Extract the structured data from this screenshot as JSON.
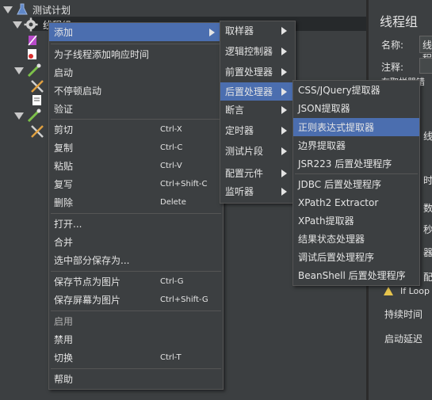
{
  "tree": {
    "root_label": "测试计划",
    "selected_label": "线程组",
    "colors": {
      "selection": "#26292b",
      "menu_highlight": "#4b6eaf"
    }
  },
  "right_panel": {
    "title": "线程组",
    "name_label": "名称:",
    "name_value": "线程",
    "comment_label": "注释:",
    "truncated_label_1": "在取样器错",
    "truncated_label_2": "线",
    "truncated_label_3": "时",
    "truncated_label_4": "数",
    "truncated_label_5": "秒",
    "truncated_label_6": "器",
    "loop_label": "线",
    "delay_label": "配",
    "warning_text": "If Loop C",
    "duration_label": "持续时间",
    "startup_delay_label": "启动延迟"
  },
  "context_menu": {
    "items": [
      {
        "label": "添加",
        "shortcut": "",
        "submenu": true
      },
      {
        "label": "为子线程添加响应时间",
        "shortcut": ""
      },
      {
        "label": "启动",
        "shortcut": ""
      },
      {
        "label": "不停顿启动",
        "shortcut": ""
      },
      {
        "label": "验证",
        "shortcut": ""
      },
      {
        "label": "剪切",
        "shortcut": "Ctrl-X"
      },
      {
        "label": "复制",
        "shortcut": "Ctrl-C"
      },
      {
        "label": "粘贴",
        "shortcut": "Ctrl-V"
      },
      {
        "label": "复写",
        "shortcut": "Ctrl+Shift-C"
      },
      {
        "label": "删除",
        "shortcut": "Delete"
      },
      {
        "label": "打开...",
        "shortcut": ""
      },
      {
        "label": "合并",
        "shortcut": ""
      },
      {
        "label": "选中部分保存为...",
        "shortcut": ""
      },
      {
        "label": "保存节点为图片",
        "shortcut": "Ctrl-G"
      },
      {
        "label": "保存屏幕为图片",
        "shortcut": "Ctrl+Shift-G"
      },
      {
        "label": "启用",
        "shortcut": ""
      },
      {
        "label": "禁用",
        "shortcut": ""
      },
      {
        "label": "切换",
        "shortcut": "Ctrl-T"
      },
      {
        "label": "帮助",
        "shortcut": ""
      }
    ]
  },
  "add_submenu": {
    "items": [
      {
        "label": "取样器"
      },
      {
        "label": "逻辑控制器"
      },
      {
        "label": "前置处理器"
      },
      {
        "label": "后置处理器"
      },
      {
        "label": "断言"
      },
      {
        "label": "定时器"
      },
      {
        "label": "测试片段"
      },
      {
        "label": "配置元件"
      },
      {
        "label": "监听器"
      }
    ]
  },
  "post_processor_submenu": {
    "items": [
      {
        "label": "CSS/JQuery提取器"
      },
      {
        "label": "JSON提取器"
      },
      {
        "label": "正则表达式提取器"
      },
      {
        "label": "边界提取器"
      },
      {
        "label": "JSR223 后置处理程序"
      },
      {
        "label": "JDBC 后置处理程序"
      },
      {
        "label": "XPath2 Extractor"
      },
      {
        "label": "XPath提取器"
      },
      {
        "label": "结果状态处理器"
      },
      {
        "label": "调试后置处理程序"
      },
      {
        "label": "BeanShell 后置处理程序"
      }
    ]
  }
}
